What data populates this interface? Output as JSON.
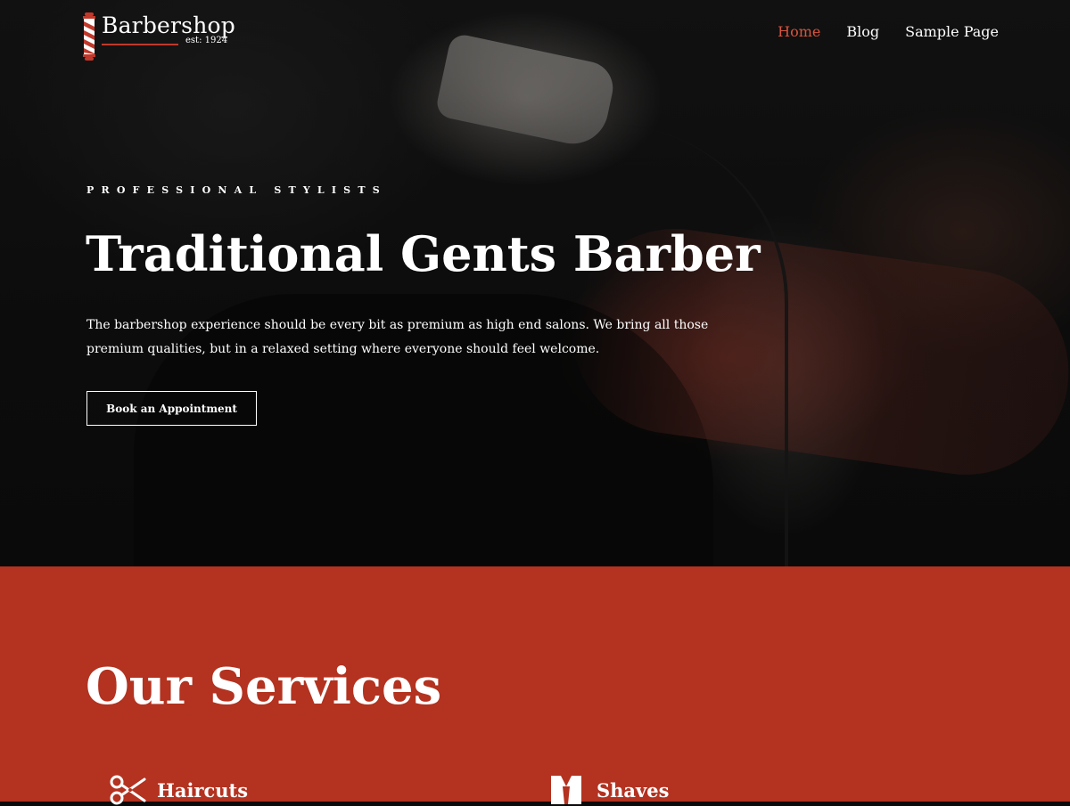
{
  "header": {
    "logo": {
      "name": "Barbershop",
      "est": "est: 1924",
      "icon": "barber-pole-icon"
    },
    "nav": [
      {
        "label": "Home",
        "active": true
      },
      {
        "label": "Blog",
        "active": false
      },
      {
        "label": "Sample Page",
        "active": false
      }
    ]
  },
  "hero": {
    "kicker": "PROFESSIONAL STYLISTS",
    "headline": "Traditional Gents Barber",
    "intro": "The barbershop experience should be every bit as premium as high end salons. We bring all those premium qualities, but in a relaxed setting where everyone should feel welcome.",
    "cta": "Book an Appointment"
  },
  "services": {
    "title": "Our Services",
    "items": [
      {
        "name": "Haircuts",
        "icon": "scissors-icon"
      },
      {
        "name": "Shaves",
        "icon": "shave-icon"
      }
    ]
  },
  "colors": {
    "accent": "#d9553f",
    "section_bg": "#b33220",
    "brand_rule": "#c0392b"
  }
}
